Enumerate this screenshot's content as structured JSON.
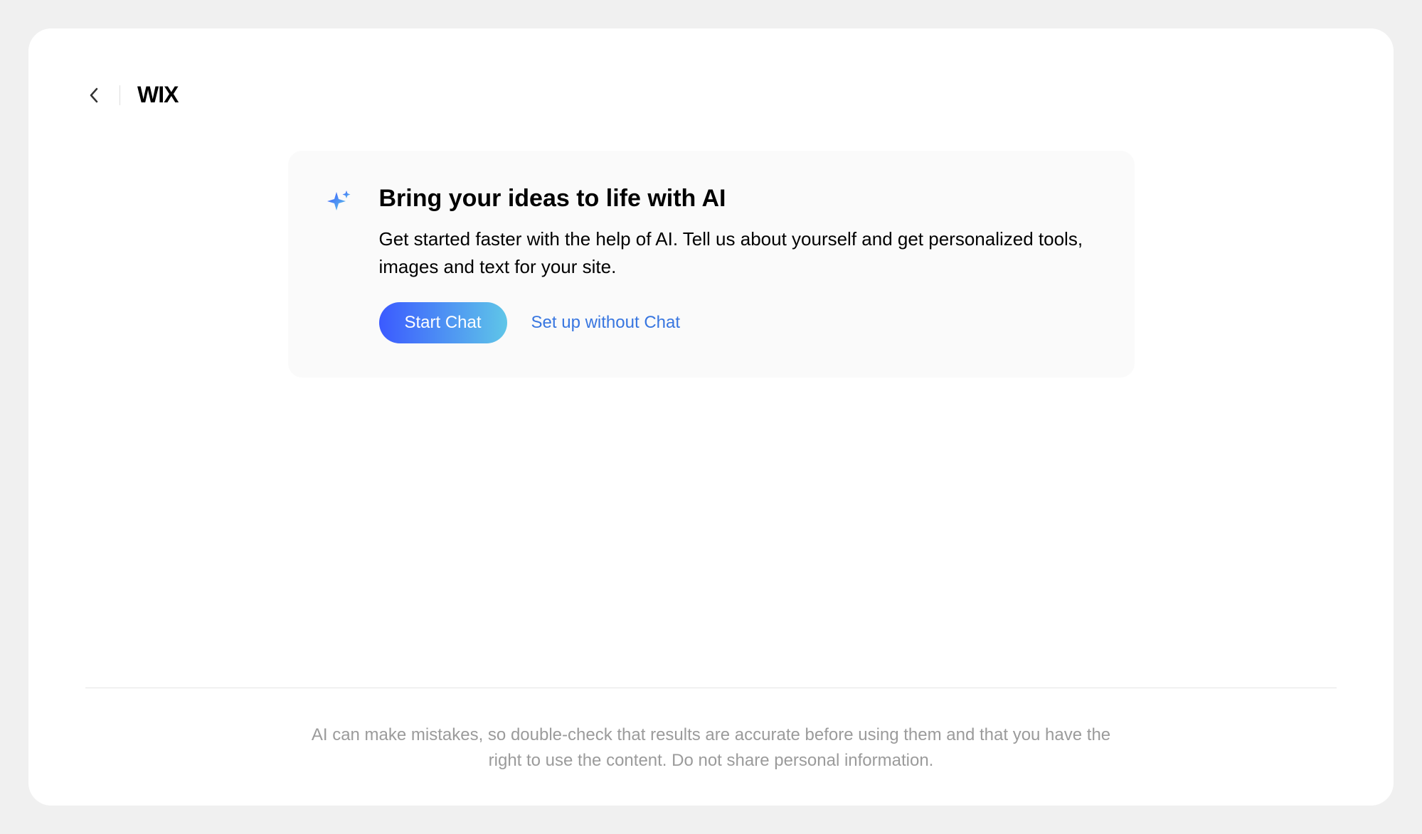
{
  "header": {
    "logo": "WIX"
  },
  "ai_card": {
    "title": "Bring your ideas to life with AI",
    "description": "Get started faster with the help of AI. Tell us about yourself and get personalized tools, images and text for your site.",
    "primary_button": "Start Chat",
    "secondary_link": "Set up without Chat"
  },
  "footer": {
    "disclaimer": "AI can make mistakes, so double-check that results are accurate before using them and that you have the right to use the content. Do not share personal information."
  }
}
